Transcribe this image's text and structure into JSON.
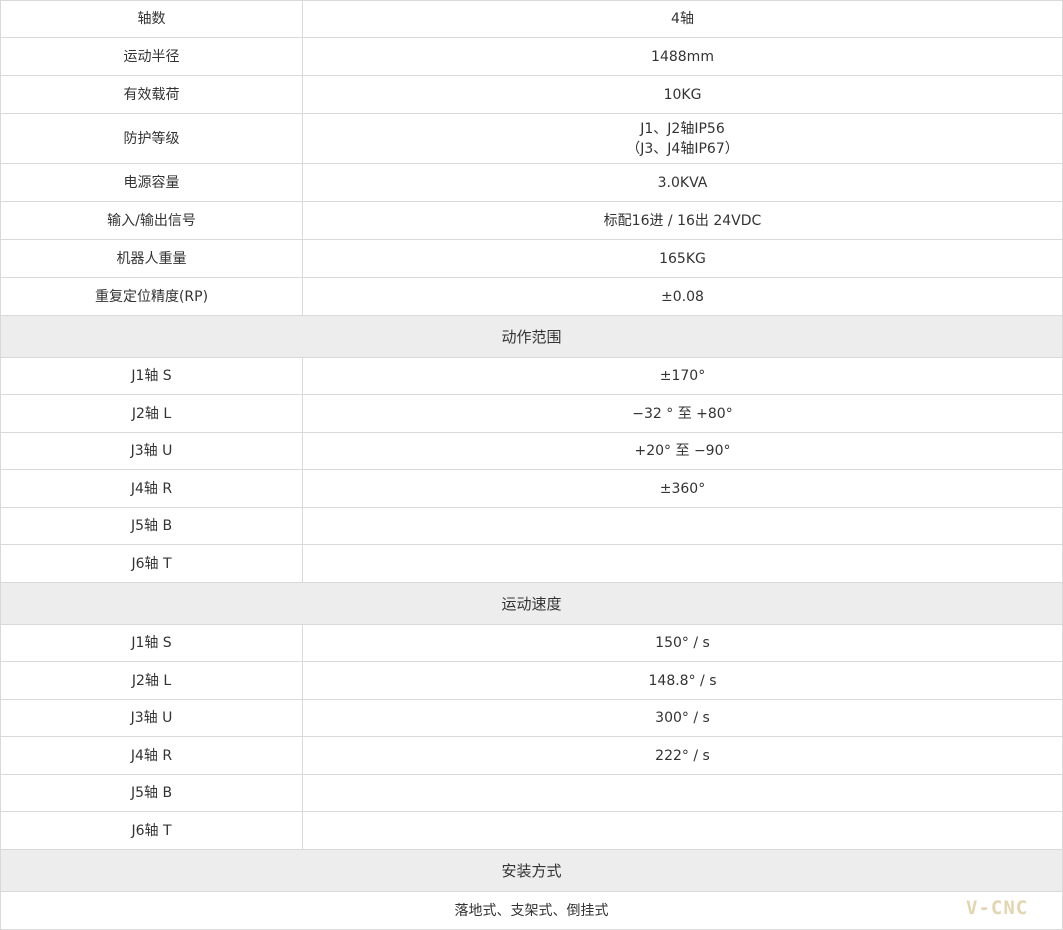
{
  "specs": [
    {
      "label": "轴数",
      "value": "4轴"
    },
    {
      "label": "运动半径",
      "value": "1488mm"
    },
    {
      "label": "有效载荷",
      "value": "10KG"
    },
    {
      "label": "防护等级",
      "value": "J1、J2轴IP56\n（J3、J4轴IP67）"
    },
    {
      "label": "电源容量",
      "value": "3.0KVA"
    },
    {
      "label": "输入/输出信号",
      "value": "标配16进 / 16出 24VDC"
    },
    {
      "label": "机器人重量",
      "value": "165KG"
    },
    {
      "label": "重复定位精度(RP)",
      "value": "±0.08"
    }
  ],
  "motion_range": {
    "title": "动作范围",
    "rows": [
      {
        "label": "J1轴 S",
        "value": "±170°"
      },
      {
        "label": "J2轴 L",
        "value": "−32 ° 至 +80°"
      },
      {
        "label": "J3轴 U",
        "value": "+20° 至 −90°"
      },
      {
        "label": "J4轴 R",
        "value": "±360°"
      },
      {
        "label": "J5轴 B",
        "value": ""
      },
      {
        "label": "J6轴 T",
        "value": ""
      }
    ]
  },
  "motion_speed": {
    "title": "运动速度",
    "rows": [
      {
        "label": "J1轴 S",
        "value": "150° / s"
      },
      {
        "label": "J2轴 L",
        "value": "148.8° / s"
      },
      {
        "label": "J3轴 U",
        "value": "300° / s"
      },
      {
        "label": "J4轴 R",
        "value": "222° / s"
      },
      {
        "label": "J5轴 B",
        "value": ""
      },
      {
        "label": "J6轴 T",
        "value": ""
      }
    ]
  },
  "mounting": {
    "title": "安装方式",
    "value": "落地式、支架式、倒挂式"
  },
  "watermark": "V-CNC",
  "colors": {
    "border": "#d9d9d9",
    "section_bg": "#ededed",
    "text": "#333333",
    "watermark": "#e2d5b0"
  }
}
